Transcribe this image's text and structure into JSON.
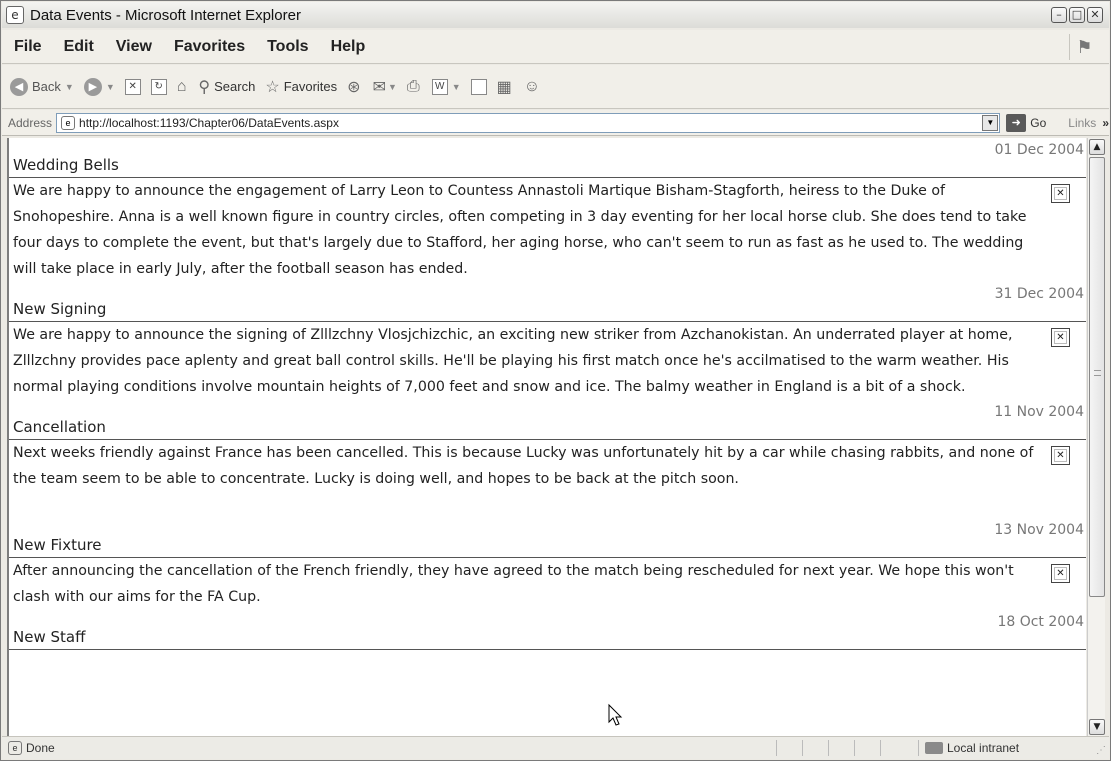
{
  "window": {
    "title": "Data Events - Microsoft Internet Explorer"
  },
  "menu": [
    "File",
    "Edit",
    "View",
    "Favorites",
    "Tools",
    "Help"
  ],
  "toolbar": {
    "back_label": "Back",
    "search_label": "Search",
    "favorites_label": "Favorites"
  },
  "address": {
    "label": "Address",
    "url": "http://localhost:1193/Chapter06/DataEvents.aspx",
    "go_label": "Go",
    "links_label": "Links"
  },
  "events": [
    {
      "title": "Wedding Bells",
      "date": "01 Dec 2004",
      "body": "We are happy to announce the engagement of Larry Leon to Countess Annastoli Martique Bisham-Stagforth, heiress to the Duke of Snohopeshire. Anna is a well known figure in country circles, often competing in 3 day eventing for her local horse club. She does tend to take four days to complete the event, but that's largely due to Stafford, her aging horse, who can't seem to run as fast as he used to. The wedding will take place in early July, after the football season has ended."
    },
    {
      "title": "New Signing",
      "date": "31 Dec 2004",
      "body": "We are happy to announce the signing of Zlllzchny Vlosjchizchic, an exciting new striker from Azchanokistan. An underrated player at home, Zlllzchny provides pace aplenty and great ball control skills. He'll be playing his first match once he's accilmatised to the warm weather. His normal playing conditions involve mountain heights of 7,000 feet and snow and ice. The balmy weather in England is a bit of a shock."
    },
    {
      "title": "Cancellation",
      "date": "11 Nov 2004",
      "body": "Next weeks friendly against France has been cancelled. This is because Lucky was unfortunately hit by a car while chasing rabbits, and none of the team seem to be able to concentrate. Lucky is doing well, and hopes to be back at the pitch soon."
    },
    {
      "title": "New Fixture",
      "date": "13 Nov 2004",
      "body": "After announcing the cancellation of the French friendly, they have agreed to the match being rescheduled for next year. We hope this won't clash with our aims for the FA Cup."
    },
    {
      "title": "New Staff",
      "date": "18 Oct 2004",
      "body": ""
    }
  ],
  "status": {
    "text": "Done",
    "zone": "Local intranet"
  }
}
